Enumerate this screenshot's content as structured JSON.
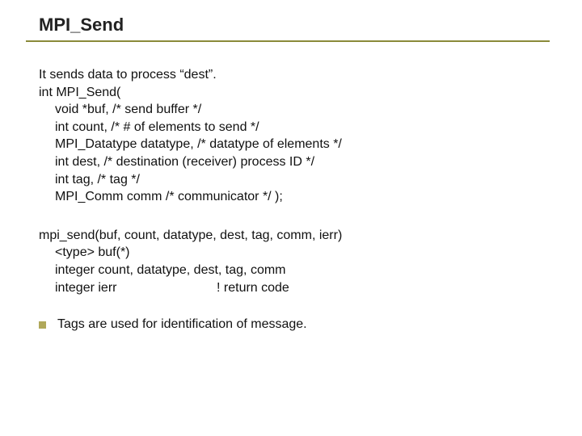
{
  "title": "MPI_Send",
  "c_block": {
    "intro": "It sends data to process “dest”.",
    "sig": "int MPI_Send(",
    "p1": "void *buf, /* send buffer */",
    "p2": "int count, /* # of elements to send */",
    "p3": "MPI_Datatype datatype, /* datatype of elements */",
    "p4": "int dest, /* destination (receiver) process ID */",
    "p5": "int tag, /* tag */",
    "p6": "MPI_Comm comm /* communicator */ );"
  },
  "f_block": {
    "sig": "mpi_send(buf, count, datatype, dest, tag, comm, ierr)",
    "l1": "<type> buf(*)",
    "l2": "integer count, datatype, dest, tag, comm",
    "l3a": "integer ierr",
    "l3b": "! return code"
  },
  "bullet": "Tags are used for identification of message."
}
